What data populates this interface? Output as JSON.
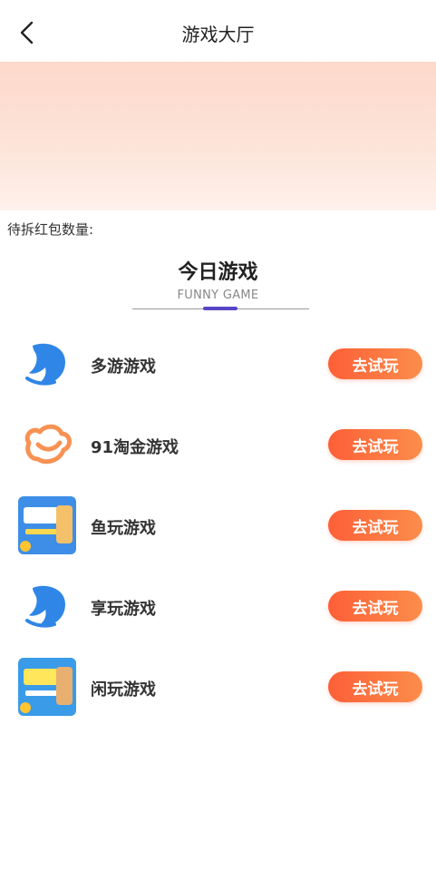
{
  "header": {
    "title": "游戏大厅",
    "back_icon": "chevron-left-icon"
  },
  "pending": {
    "label": "待拆红包数量:"
  },
  "section": {
    "title": "今日游戏",
    "subtitle": "FUNNY GAME",
    "accent": "#5645c6"
  },
  "games": [
    {
      "name": "多游游戏",
      "icon": "dolphin-logo-icon",
      "button": "去试玩"
    },
    {
      "name": "91淘金游戏",
      "icon": "cloud-logo-icon",
      "button": "去试玩"
    },
    {
      "name": "鱼玩游戏",
      "icon": "game-thumbnail-icon",
      "button": "去试玩"
    },
    {
      "name": "享玩游戏",
      "icon": "dolphin-logo-icon",
      "button": "去试玩"
    },
    {
      "name": "闲玩游戏",
      "icon": "game-thumbnail-icon",
      "button": "去试玩"
    }
  ],
  "colors": {
    "button_start": "#fd5f37",
    "button_end": "#fb8d4b",
    "banner": "#fdd9cb"
  }
}
